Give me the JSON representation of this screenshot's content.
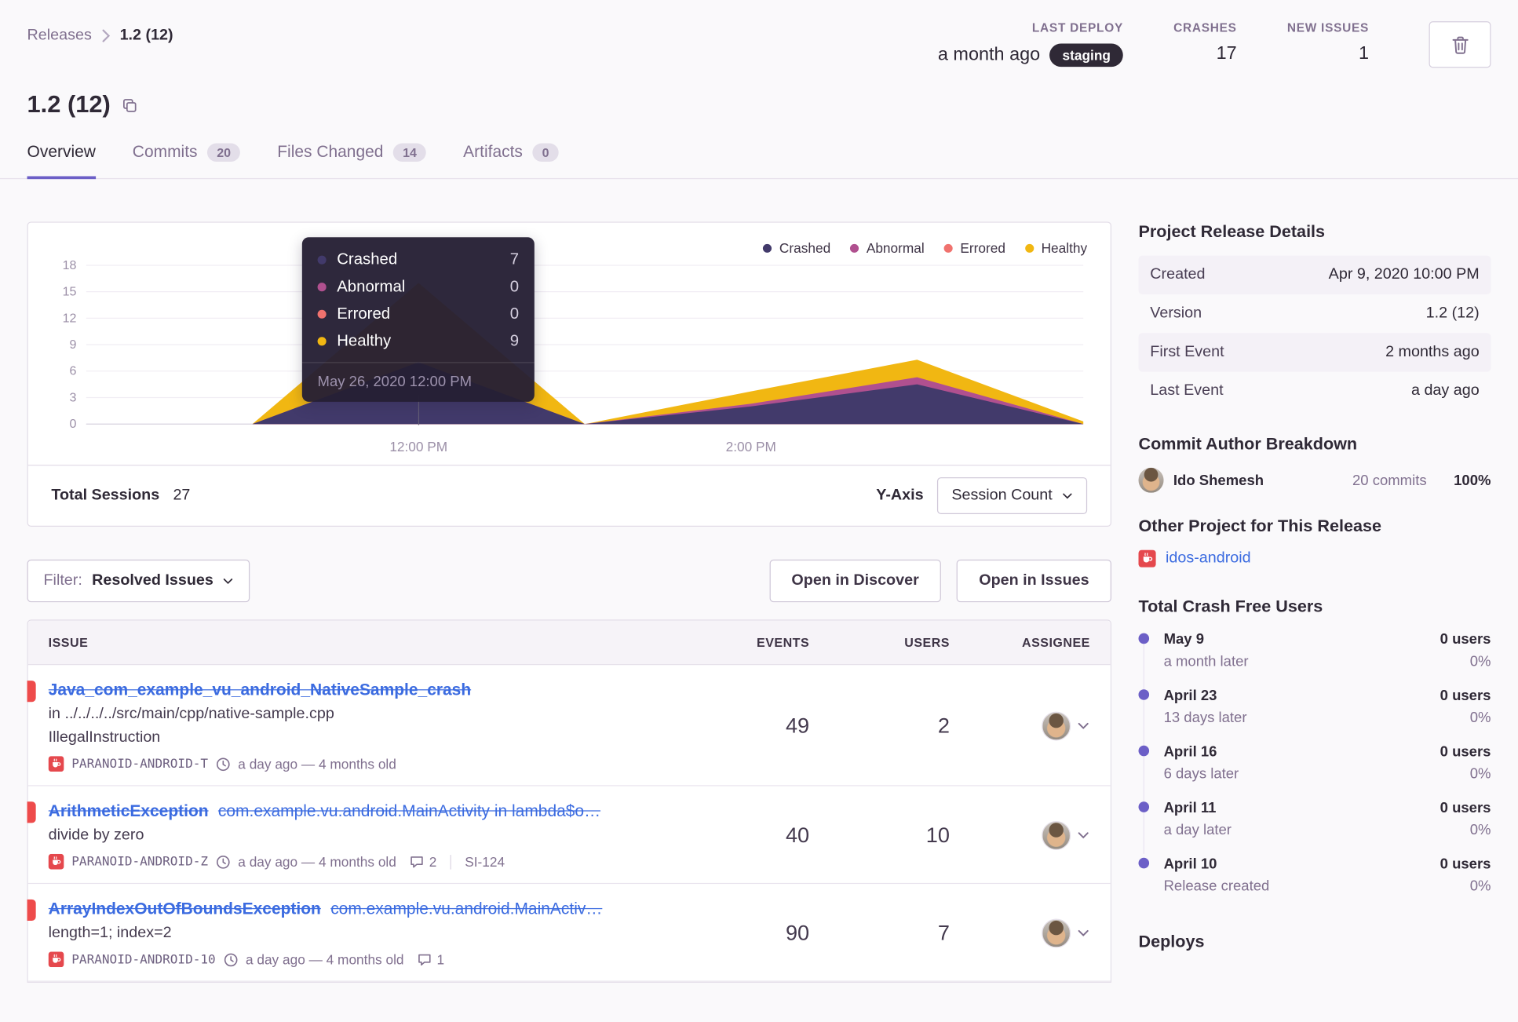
{
  "colors": {
    "accent": "#6c5fc7",
    "link": "#3b6be0",
    "resolved_marker": "#ee4b4b",
    "staging_badge_bg": "#2f2936",
    "crashed": "#423a6b",
    "abnormal": "#b0508f",
    "errored": "#f0726e",
    "healthy": "#f1b712"
  },
  "breadcrumb": {
    "root": "Releases",
    "current": "1.2 (12)"
  },
  "header_stats": {
    "last_deploy_label": "LAST DEPLOY",
    "last_deploy_value": "a month ago",
    "last_deploy_badge": "staging",
    "crashes_label": "CRASHES",
    "crashes_value": "17",
    "new_issues_label": "NEW ISSUES",
    "new_issues_value": "1"
  },
  "page_title": "1.2 (12)",
  "tabs": [
    {
      "label": "Overview",
      "badge": null,
      "active": true
    },
    {
      "label": "Commits",
      "badge": "20",
      "active": false
    },
    {
      "label": "Files Changed",
      "badge": "14",
      "active": false
    },
    {
      "label": "Artifacts",
      "badge": "0",
      "active": false
    }
  ],
  "chart_card": {
    "tooltip": {
      "rows": [
        {
          "label": "Crashed",
          "value": "7"
        },
        {
          "label": "Abnormal",
          "value": "0"
        },
        {
          "label": "Errored",
          "value": "0"
        },
        {
          "label": "Healthy",
          "value": "9"
        }
      ],
      "date": "May 26, 2020 12:00 PM"
    },
    "footer": {
      "total_label": "Total Sessions",
      "total_value": "27",
      "yaxis_label": "Y-Axis",
      "yaxis_value": "Session Count"
    }
  },
  "chart_data": {
    "type": "area",
    "stacked": true,
    "title": "Release session health over time",
    "x": [
      "10:00 AM",
      "11:00 AM",
      "12:00 PM",
      "1:00 PM",
      "2:00 PM",
      "3:00 PM",
      "4:00 PM"
    ],
    "series": [
      {
        "name": "Crashed",
        "color": "#423a6b",
        "values": [
          0,
          0,
          7,
          0,
          2,
          4.5,
          0
        ]
      },
      {
        "name": "Abnormal",
        "color": "#b0508f",
        "values": [
          0,
          0,
          0,
          0,
          0.3,
          0.8,
          0
        ]
      },
      {
        "name": "Errored",
        "color": "#f0726e",
        "values": [
          0,
          0,
          0,
          0,
          0,
          0,
          0
        ]
      },
      {
        "name": "Healthy",
        "color": "#f1b712",
        "values": [
          0,
          0,
          9,
          0,
          1.4,
          2,
          0.3
        ]
      }
    ],
    "ylim": [
      0,
      18
    ],
    "yticks": [
      0,
      3,
      6,
      9,
      12,
      15,
      18
    ],
    "xtick_labels": [
      {
        "index": 2,
        "label": "12:00 PM"
      },
      {
        "index": 4,
        "label": "2:00 PM"
      }
    ],
    "grid": true,
    "legend_position": "top-right",
    "tooltip_point": {
      "x_index": 2,
      "date": "May 26, 2020 12:00 PM",
      "values": {
        "Crashed": 7,
        "Abnormal": 0,
        "Errored": 0,
        "Healthy": 9
      }
    }
  },
  "filter_bar": {
    "filter_label": "Filter:",
    "filter_value": "Resolved Issues",
    "open_discover": "Open in Discover",
    "open_issues": "Open in Issues"
  },
  "issues_table": {
    "headers": {
      "issue": "ISSUE",
      "events": "EVENTS",
      "users": "USERS",
      "assignee": "ASSIGNEE"
    },
    "rows": [
      {
        "title": "Java_com_example_vu_android_NativeSample_crash",
        "culprit": null,
        "location": "in ../../../../src/main/cpp/native-sample.cpp",
        "message": "IllegalInstruction",
        "project": "PARANOID-ANDROID-T",
        "age": "a day ago — 4 months old",
        "comments": null,
        "short_id": null,
        "events": "49",
        "users": "2"
      },
      {
        "title": "ArithmeticException",
        "culprit": "com.example.vu.android.MainActivity in lambda$o…",
        "location": null,
        "message": "divide by zero",
        "project": "PARANOID-ANDROID-Z",
        "age": "a day ago — 4 months old",
        "comments": "2",
        "short_id": "SI-124",
        "events": "40",
        "users": "10"
      },
      {
        "title": "ArrayIndexOutOfBoundsException",
        "culprit": "com.example.vu.android.MainActiv…",
        "location": null,
        "message": "length=1; index=2",
        "project": "PARANOID-ANDROID-10",
        "age": "a day ago — 4 months old",
        "comments": "1",
        "short_id": null,
        "events": "90",
        "users": "7"
      }
    ]
  },
  "sidebar": {
    "release_details": {
      "title": "Project Release Details",
      "rows": [
        {
          "label": "Created",
          "value": "Apr 9, 2020 10:00 PM"
        },
        {
          "label": "Version",
          "value": "1.2 (12)"
        },
        {
          "label": "First Event",
          "value": "2 months ago"
        },
        {
          "label": "Last Event",
          "value": "a day ago"
        }
      ]
    },
    "commit_authors": {
      "title": "Commit Author Breakdown",
      "rows": [
        {
          "name": "Ido Shemesh",
          "commits": "20 commits",
          "percent": "100%"
        }
      ]
    },
    "other_projects": {
      "title": "Other Project for This Release",
      "projects": [
        {
          "name": "idos-android"
        }
      ]
    },
    "crash_free": {
      "title": "Total Crash Free Users",
      "entries": [
        {
          "date": "May 9",
          "sub": "a month later",
          "users": "0 users",
          "percent": "0%"
        },
        {
          "date": "April 23",
          "sub": "13 days later",
          "users": "0 users",
          "percent": "0%"
        },
        {
          "date": "April 16",
          "sub": "6 days later",
          "users": "0 users",
          "percent": "0%"
        },
        {
          "date": "April 11",
          "sub": "a day later",
          "users": "0 users",
          "percent": "0%"
        },
        {
          "date": "April 10",
          "sub": "Release created",
          "users": "0 users",
          "percent": "0%"
        }
      ]
    },
    "deploys_title": "Deploys"
  }
}
